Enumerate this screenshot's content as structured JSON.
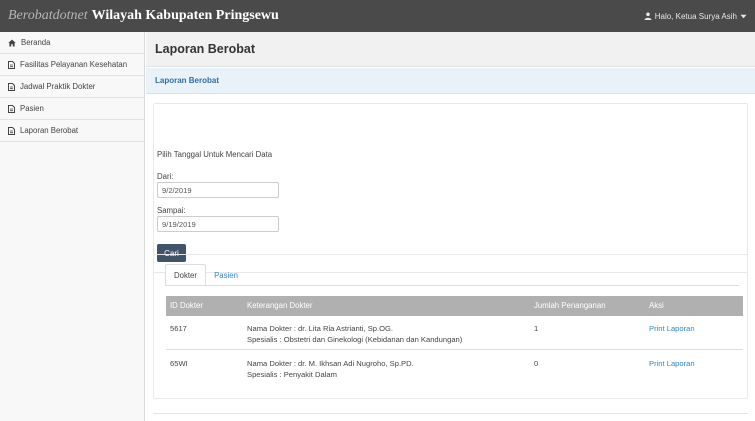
{
  "topbar": {
    "site_name": "Berobatdotnet",
    "region_name": "Wilayah Kabupaten Pringsewu",
    "user_greeting": "Halo, Ketua Surya Asih"
  },
  "sidebar": {
    "items": [
      {
        "label": "Beranda",
        "icon": "home-icon"
      },
      {
        "label": "Fasilitas Pelayanan Kesehatan",
        "icon": "document-icon"
      },
      {
        "label": "Jadwal Praktik Dokter",
        "icon": "document-icon"
      },
      {
        "label": "Pasien",
        "icon": "document-icon"
      },
      {
        "label": "Laporan Berobat",
        "icon": "document-icon"
      }
    ]
  },
  "page": {
    "title": "Laporan Berobat",
    "panel_heading": "Laporan Berobat"
  },
  "form": {
    "instruction": "Pilih Tanggal Untuk Mencari Data",
    "from_label": "Dari:",
    "from_value": "9/2/2019",
    "to_label": "Sampai:",
    "to_value": "9/19/2019",
    "search_button": "Cari"
  },
  "tabs": [
    {
      "label": "Dokter",
      "active": true
    },
    {
      "label": "Pasien",
      "active": false
    }
  ],
  "table": {
    "columns": [
      "ID Dokter",
      "Keterangan Dokter",
      "Jumlah Penanganan",
      "Aksi"
    ],
    "rows": [
      {
        "id": "5617",
        "doctor_name": "Nama Dokter : dr. Lita Ria Astrianti, Sp.OG.",
        "specialty": "Spesialis : Obstetri dan Ginekologi (Kebidanan dan Kandungan)",
        "count": "1",
        "action": "Print Laporan"
      },
      {
        "id": "65WI",
        "doctor_name": "Nama Dokter : dr. M. Ikhsan Adi Nugroho, Sp.PD.",
        "specialty": "Spesialis : Penyakit Dalam",
        "count": "0",
        "action": "Print Laporan"
      }
    ]
  },
  "colors": {
    "topbar": "#4a4a4a",
    "sidebar": "#f8f8f8",
    "button": "#3f5468",
    "link": "#2f87c6",
    "table_header": "#b0b0b0"
  }
}
